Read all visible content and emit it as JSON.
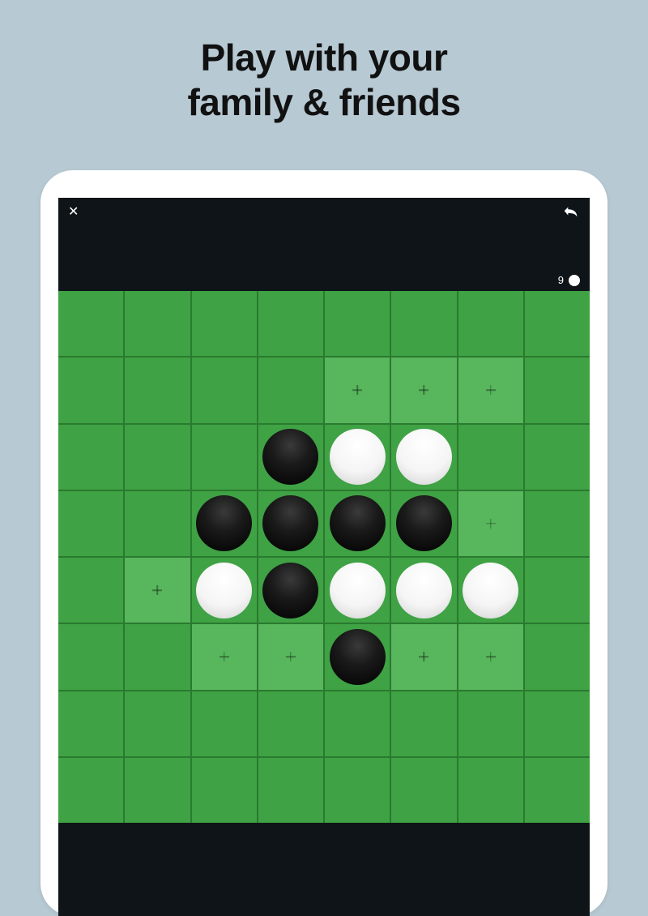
{
  "headline_line1": "Play with your",
  "headline_line2": "family & friends",
  "game": {
    "close_label": "✕",
    "score_white": "9",
    "board_size": 8,
    "pieces": [
      {
        "row": 2,
        "col": 3,
        "color": "black"
      },
      {
        "row": 2,
        "col": 4,
        "color": "white"
      },
      {
        "row": 2,
        "col": 5,
        "color": "white"
      },
      {
        "row": 3,
        "col": 2,
        "color": "black"
      },
      {
        "row": 3,
        "col": 3,
        "color": "black"
      },
      {
        "row": 3,
        "col": 4,
        "color": "black"
      },
      {
        "row": 3,
        "col": 5,
        "color": "black"
      },
      {
        "row": 4,
        "col": 2,
        "color": "white"
      },
      {
        "row": 4,
        "col": 3,
        "color": "black"
      },
      {
        "row": 4,
        "col": 4,
        "color": "white"
      },
      {
        "row": 4,
        "col": 5,
        "color": "white"
      },
      {
        "row": 4,
        "col": 6,
        "color": "white"
      },
      {
        "row": 5,
        "col": 4,
        "color": "black"
      }
    ],
    "hints": [
      {
        "row": 1,
        "col": 4
      },
      {
        "row": 1,
        "col": 5
      },
      {
        "row": 1,
        "col": 6
      },
      {
        "row": 3,
        "col": 6
      },
      {
        "row": 4,
        "col": 1
      },
      {
        "row": 5,
        "col": 2
      },
      {
        "row": 5,
        "col": 3
      },
      {
        "row": 5,
        "col": 5
      },
      {
        "row": 5,
        "col": 6
      }
    ]
  }
}
